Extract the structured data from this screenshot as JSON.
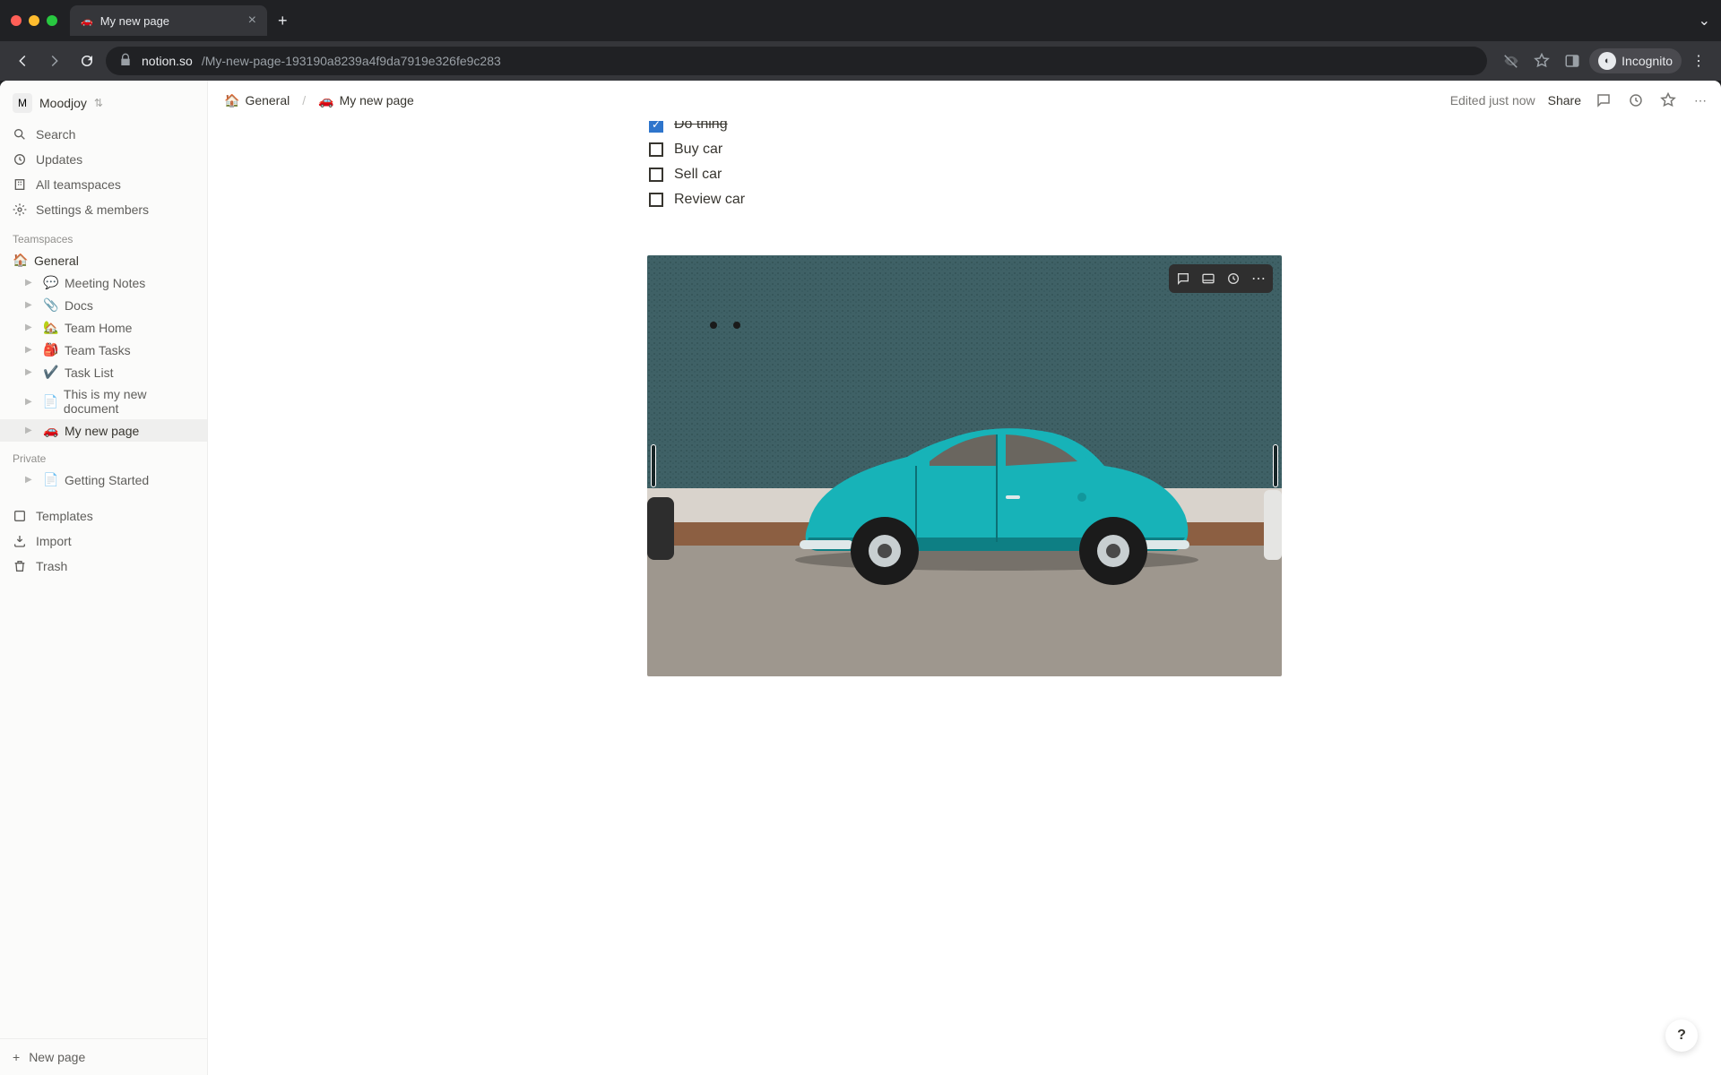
{
  "browser": {
    "tab_title": "My new page",
    "tab_favicon": "🚗",
    "url_host": "notion.so",
    "url_path": "/My-new-page-193190a8239a4f9da7919e326fe9c283",
    "incognito_label": "Incognito"
  },
  "workspace": {
    "avatar_initial": "M",
    "name": "Moodjoy"
  },
  "sidebar": {
    "search": "Search",
    "updates": "Updates",
    "all_teamspaces": "All teamspaces",
    "settings": "Settings & members",
    "teamspaces_header": "Teamspaces",
    "private_header": "Private",
    "templates": "Templates",
    "import": "Import",
    "trash": "Trash",
    "new_page": "New page",
    "teamspace": {
      "name": "General",
      "icon": "🏠",
      "pages": [
        {
          "icon": "💬",
          "label": "Meeting Notes"
        },
        {
          "icon": "📎",
          "label": "Docs"
        },
        {
          "icon": "🏡",
          "label": "Team Home"
        },
        {
          "icon": "🎒",
          "label": "Team Tasks"
        },
        {
          "icon": "✔️",
          "label": "Task List"
        },
        {
          "icon": "📄",
          "label": "This is my new document"
        },
        {
          "icon": "🚗",
          "label": "My new page"
        }
      ]
    },
    "private_pages": [
      {
        "icon": "📄",
        "label": "Getting Started"
      }
    ]
  },
  "topbar": {
    "crumb1_icon": "🏠",
    "crumb1_label": "General",
    "crumb2_icon": "🚗",
    "crumb2_label": "My new page",
    "edited": "Edited just now",
    "share": "Share"
  },
  "content": {
    "todos": [
      {
        "label": "Do thing",
        "checked": true,
        "partial": true
      },
      {
        "label": "Buy car",
        "checked": false
      },
      {
        "label": "Sell car",
        "checked": false
      },
      {
        "label": "Review car",
        "checked": false
      }
    ]
  }
}
